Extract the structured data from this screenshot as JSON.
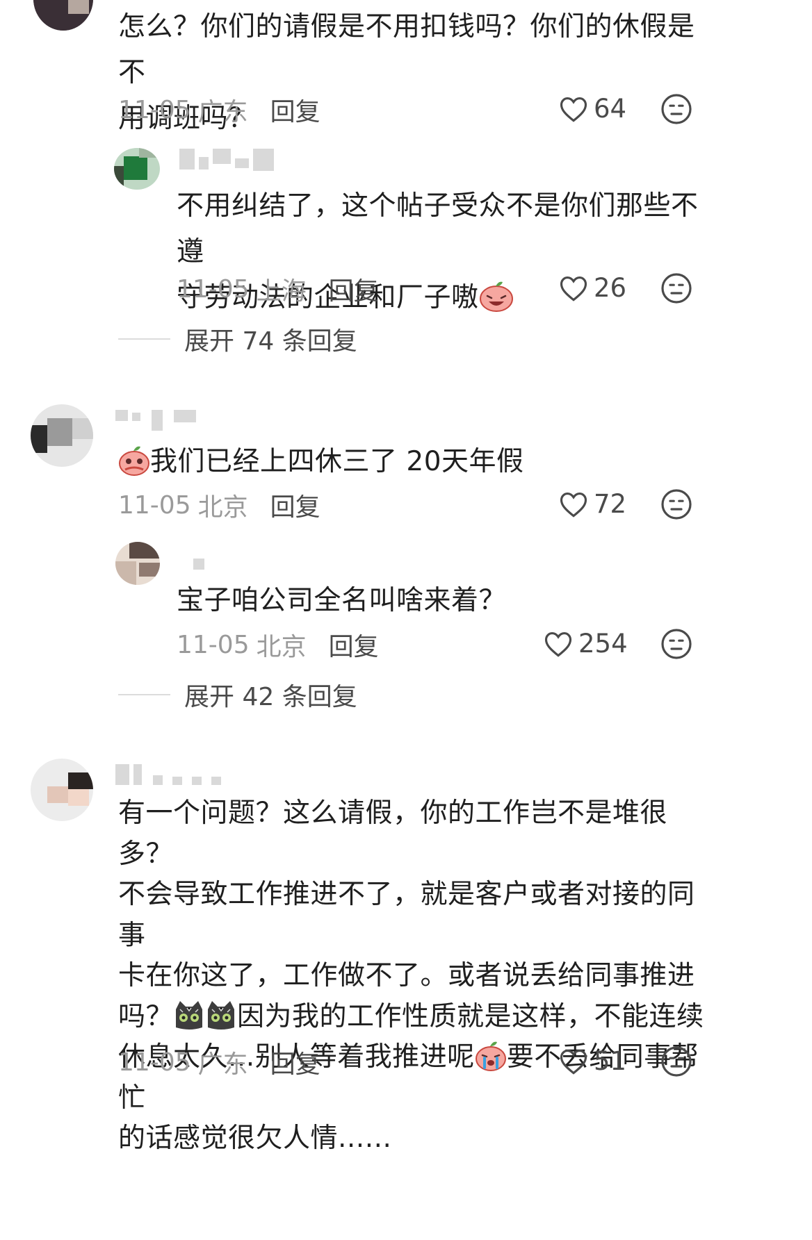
{
  "comments": [
    {
      "text_line1": "怎么？你们的请假是不用扣钱吗？你们的休假是不",
      "text_line2": "用调班吗？",
      "date": "11-05",
      "location": "广东",
      "reply_label": "回复",
      "likes": "64"
    },
    {
      "text_line1": "不用纠结了，这个帖子受众不是你们那些不遵",
      "text_line2": "守劳动法的企业和厂子嗷",
      "emoji_end": "laughing-face-emoji",
      "date": "11-05",
      "location": "上海",
      "reply_label": "回复",
      "likes": "26"
    },
    {
      "expand_label": "展开 74 条回复"
    },
    {
      "emoji_start": "pleading-face-emoji",
      "text_line1": "我们已经上四休三了 20天年假",
      "date": "11-05",
      "location": "北京",
      "reply_label": "回复",
      "likes": "72"
    },
    {
      "text_line1": "宝子咱公司全名叫啥来着？",
      "date": "11-05",
      "location": "北京",
      "reply_label": "回复",
      "likes": "254"
    },
    {
      "expand_label": "展开 42 条回复"
    },
    {
      "text_line1": "有一个问题？这么请假，你的工作岂不是堆很多？",
      "text_line2": "不会导致工作推进不了，就是客户或者对接的同事",
      "text_line3": "卡在你这了，工作做不了。或者说丢给同事推进",
      "text_line4a": "吗？",
      "text_line4b": "因为我的工作性质就是这样，不能连续",
      "text_line5a": "休息太久...别人等着我推进呢",
      "text_line5b": "要不丢给同事帮忙",
      "text_line6": "的话感觉很欠人情......",
      "date": "11-05",
      "location": "广东",
      "reply_label": "回复",
      "likes": "51"
    }
  ],
  "icons": {
    "like": "heart-outline-icon",
    "dislike": "meh-face-icon",
    "cat_emoji": "cat-face-emoji",
    "crying_emoji": "crying-face-emoji"
  },
  "colors": {
    "text": "#1f1f1f",
    "meta": "#9a9a9a",
    "action": "#4a4a4a"
  }
}
